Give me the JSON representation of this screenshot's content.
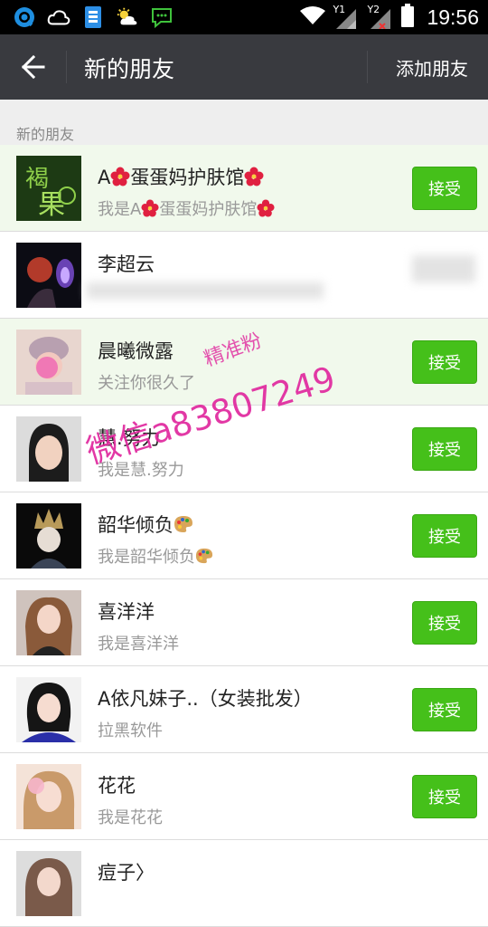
{
  "status_bar": {
    "time": "19:56",
    "sim1_label": "Y1",
    "sim2_label": "Y2",
    "icons": [
      "qq-icon",
      "cloud-icon",
      "sim-card-icon",
      "weather-icon",
      "chat-bubble-icon",
      "wifi-icon",
      "signal-icon",
      "battery-icon"
    ]
  },
  "header": {
    "title": "新的朋友",
    "action_label": "添加朋友"
  },
  "section": {
    "label": "新的朋友"
  },
  "accept_label": "接受",
  "friends": [
    {
      "name_prefix": "A",
      "name_mid": "蛋蛋妈护肤馆",
      "msg_prefix": "我是A",
      "msg_mid": "蛋蛋妈护肤馆",
      "highlight": true,
      "status": "accept"
    },
    {
      "name": "李超云",
      "msg": "",
      "highlight": false,
      "status": "blurred"
    },
    {
      "name": "晨曦微露",
      "msg": "关注你很久了",
      "highlight": true,
      "status": "accept"
    },
    {
      "name": "慧.努力",
      "msg": "我是慧.努力",
      "highlight": false,
      "status": "accept"
    },
    {
      "name": "韶华倾负",
      "msg": "我是韶华倾负",
      "highlight": false,
      "status": "accept"
    },
    {
      "name": "喜洋洋",
      "msg": "我是喜洋洋",
      "highlight": false,
      "status": "accept"
    },
    {
      "name": "A依凡妹子..（女装批发）",
      "msg": "拉黑软件",
      "highlight": false,
      "status": "accept"
    },
    {
      "name": "花花",
      "msg": "我是花花",
      "highlight": false,
      "status": "accept"
    },
    {
      "name": "痘子〉",
      "msg": "",
      "highlight": false,
      "status": "partial"
    }
  ],
  "watermark": {
    "main": "微信a83807249",
    "sub": "精准粉"
  },
  "colors": {
    "accent": "#45c01a",
    "title_bar": "#393a3f",
    "watermark": "#e0289e"
  }
}
